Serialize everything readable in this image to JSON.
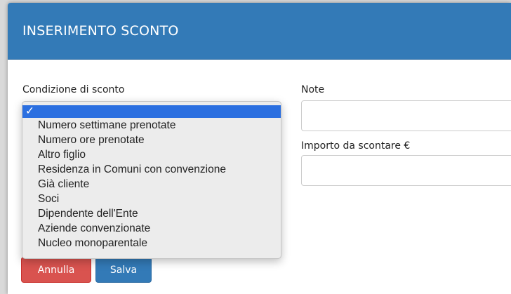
{
  "modal": {
    "title": "INSERIMENTO SCONTO"
  },
  "form": {
    "discount_condition": {
      "label": "Condizione di sconto",
      "selected_mark": "✓",
      "options": [
        "Numero settimane prenotate",
        "Numero ore prenotate",
        "Altro figlio",
        "Residenza in Comuni con convenzione",
        "Già cliente",
        "Soci",
        "Dipendente dell'Ente",
        "Aziende convenzionate",
        "Nucleo monoparentale"
      ]
    },
    "note": {
      "label": "Note",
      "value": ""
    },
    "amount": {
      "label": "Importo da scontare €",
      "value": ""
    }
  },
  "footer": {
    "cancel_label": "Annulla",
    "save_label": "Salva"
  },
  "colors": {
    "header": "#337ab7",
    "cancel": "#d9534f",
    "save": "#337ab7",
    "option_highlight": "#2b6fe0"
  }
}
